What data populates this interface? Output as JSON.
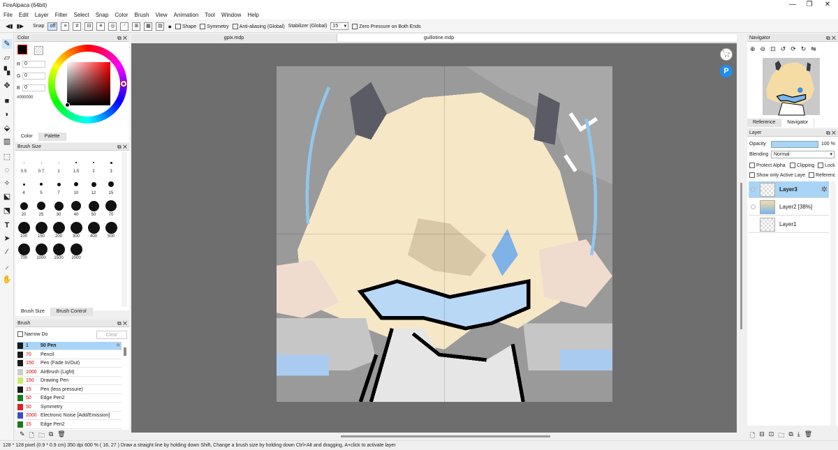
{
  "window": {
    "title": "FireAlpaca (64bit)",
    "minimize": "—",
    "maximize": "❐",
    "close": "✕"
  },
  "menu": [
    "File",
    "Edit",
    "Layer",
    "Filter",
    "Select",
    "Snap",
    "Color",
    "Brush",
    "View",
    "Animation",
    "Tool",
    "Window",
    "Help"
  ],
  "toolbar": {
    "snap_label": "Snap",
    "off_label": "off",
    "shape_label": "Shape",
    "symmetry_label": "Symmetry",
    "antialias_label": "Anti-aliasing (Global)",
    "stabilizer_label": "Stabilizer (Global)",
    "stabilizer_value": "15",
    "zero_pressure_label": "Zero Pressure on Both Ends"
  },
  "color_panel": {
    "title": "Color",
    "r_label": "R",
    "r_value": "0",
    "g_label": "G",
    "g_value": "0",
    "b_label": "B",
    "b_value": "0",
    "hex": "#000000",
    "tab_color": "Color",
    "tab_palette": "Palette",
    "accent": "#ff0000"
  },
  "brush_size_panel": {
    "title": "Brush Size",
    "sizes": [
      "0.5",
      "0.7",
      "1",
      "1.5",
      "2",
      "3",
      "4",
      "5",
      "7",
      "10",
      "12",
      "15",
      "20",
      "25",
      "30",
      "40",
      "50",
      "70",
      "100",
      "150",
      "200",
      "300",
      "400",
      "500",
      "700",
      "1000",
      "1500",
      "2000"
    ],
    "tab_size": "Brush Size",
    "tab_control": "Brush Control"
  },
  "brush_panel": {
    "title": "Brush",
    "narrow_label": "Narrow Do",
    "clear_label": "Clear",
    "items": [
      {
        "size": "1",
        "name": "50 Pen",
        "color": "#1a1a1a"
      },
      {
        "size": "70",
        "name": "Pencil",
        "color": "#1a1a1a"
      },
      {
        "size": "150",
        "name": "Pen (Fade In/Out)",
        "color": "#1a1a1a"
      },
      {
        "size": "1000",
        "name": "AirBrush (Light)",
        "color": "#cccccc"
      },
      {
        "size": "150",
        "name": "Drawing Pen",
        "color": "#c8e86a"
      },
      {
        "size": "15",
        "name": "Pen (less pressure)",
        "color": "#1a1a1a"
      },
      {
        "size": "50",
        "name": "Edge Pen2",
        "color": "#1a7a1a"
      },
      {
        "size": "50",
        "name": "Symmetry",
        "color": "#e02020"
      },
      {
        "size": "2000",
        "name": "Electronic Noise [Add/Emission]",
        "color": "#3a4ad0"
      },
      {
        "size": "15",
        "name": "Edge Pen2",
        "color": "#1a7a1a"
      }
    ]
  },
  "doc_tabs": [
    "gpix.mdp",
    "guillotine.mdp"
  ],
  "navigator": {
    "title": "Navigator",
    "tab_reference": "Reference",
    "tab_navigator": "Navigator"
  },
  "layer_panel": {
    "title": "Layer",
    "opacity_label": "Opacity",
    "opacity_value": "100 %",
    "opacity_fraction": 1.0,
    "blending_label": "Blending",
    "blending_value": "Normal",
    "protect_alpha": "Protect Alpha",
    "clipping": "Clipping",
    "lock": "Lock",
    "show_only": "Show only Active Laye",
    "reference": "Referenc",
    "layers": [
      "Layer3",
      "Layer2 [38%]",
      "Layer1"
    ]
  },
  "status": {
    "text": "128 * 128 pixel   (0.9 * 0.9 cm)   350 dpi   600 %   ( 16, 27 )   Draw a straight line by holding down Shift, Change a brush size by holding down Ctrl+Alt and dragging, A+click to activate layer"
  }
}
